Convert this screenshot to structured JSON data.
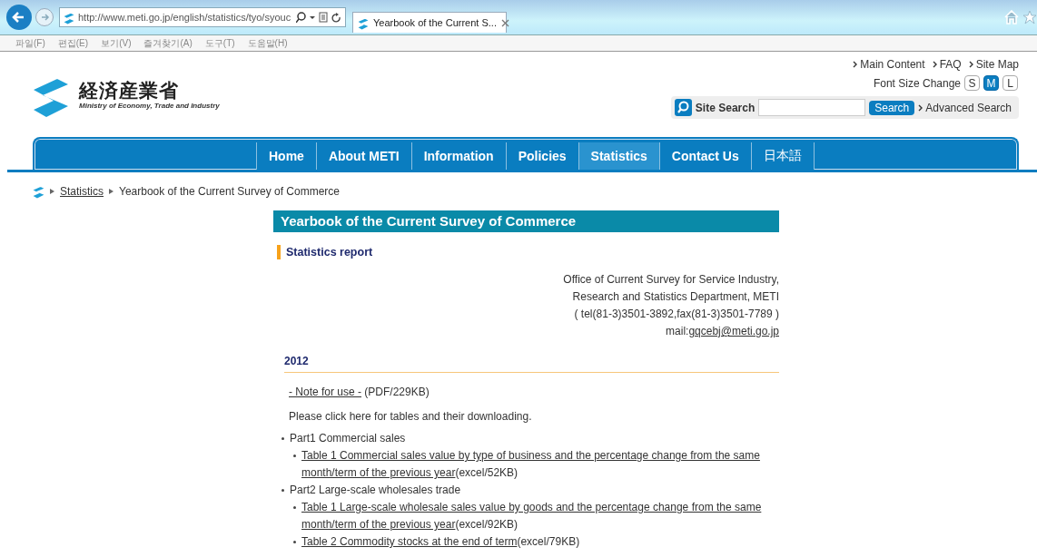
{
  "browser": {
    "url": "http://www.meti.go.jp/english/statistics/tyo/syouc",
    "tab_title": "Yearbook of the Current S...",
    "menu": [
      "파일(F)",
      "편집(E)",
      "보기(V)",
      "즐겨찾기(A)",
      "도구(T)",
      "도움말(H)"
    ]
  },
  "header": {
    "logo_text": "経済産業省",
    "logo_subtitle": "Ministry of Economy, Trade and Industry",
    "top_links": [
      "Main Content",
      "FAQ",
      "Site Map"
    ],
    "font_size": {
      "label": "Font Size Change",
      "options": [
        {
          "label": "S",
          "selected": false
        },
        {
          "label": "M",
          "selected": true
        },
        {
          "label": "L",
          "selected": false
        }
      ]
    },
    "search": {
      "label": "Site Search",
      "button": "Search",
      "link": "Advanced Search"
    }
  },
  "nav": [
    {
      "label": "Home",
      "selected": false
    },
    {
      "label": "About METI",
      "selected": false
    },
    {
      "label": "Information",
      "selected": false
    },
    {
      "label": "Policies",
      "selected": false
    },
    {
      "label": "Statistics",
      "selected": true
    },
    {
      "label": "Contact Us",
      "selected": false
    },
    {
      "label": "日本語",
      "selected": false
    }
  ],
  "breadcrumb": {
    "link": "Statistics",
    "current": "Yearbook of the Current Survey of Commerce"
  },
  "content": {
    "title": "Yearbook of the Current Survey of Commerce",
    "section": "Statistics report",
    "contact_lines": [
      "Office of Current Survey for Service Industry,",
      "Research and Statistics Department, METI",
      "( tel(81-3)3501-3892,fax(81-3)3501-7789 )"
    ],
    "mail_label": "mail:",
    "mail_link": "gqcebj@meti.go.jp",
    "year": "2012",
    "note": {
      "link": "- Note for use -",
      "suffix": " (PDF/229KB)"
    },
    "intro": "Please click here for tables and their downloading.",
    "parts": [
      {
        "label": "Part1 Commercial sales",
        "tables": [
          {
            "link_lines": [
              "Table 1 Commercial sales value by type of business and the percentage change from the same",
              "month/term of the previous year"
            ],
            "suffix": "(excel/52KB)"
          }
        ]
      },
      {
        "label": "Part2 Large-scale wholesales trade",
        "tables": [
          {
            "link_lines": [
              "Table 1 Large-scale wholesale sales value by goods and the percentage change from the same",
              "month/term of the previous year"
            ],
            "suffix": "(excel/92KB)"
          },
          {
            "link_lines": [
              "Table 2 Commodity stocks at the end of term"
            ],
            "suffix": "(excel/79KB)"
          }
        ]
      }
    ]
  }
}
